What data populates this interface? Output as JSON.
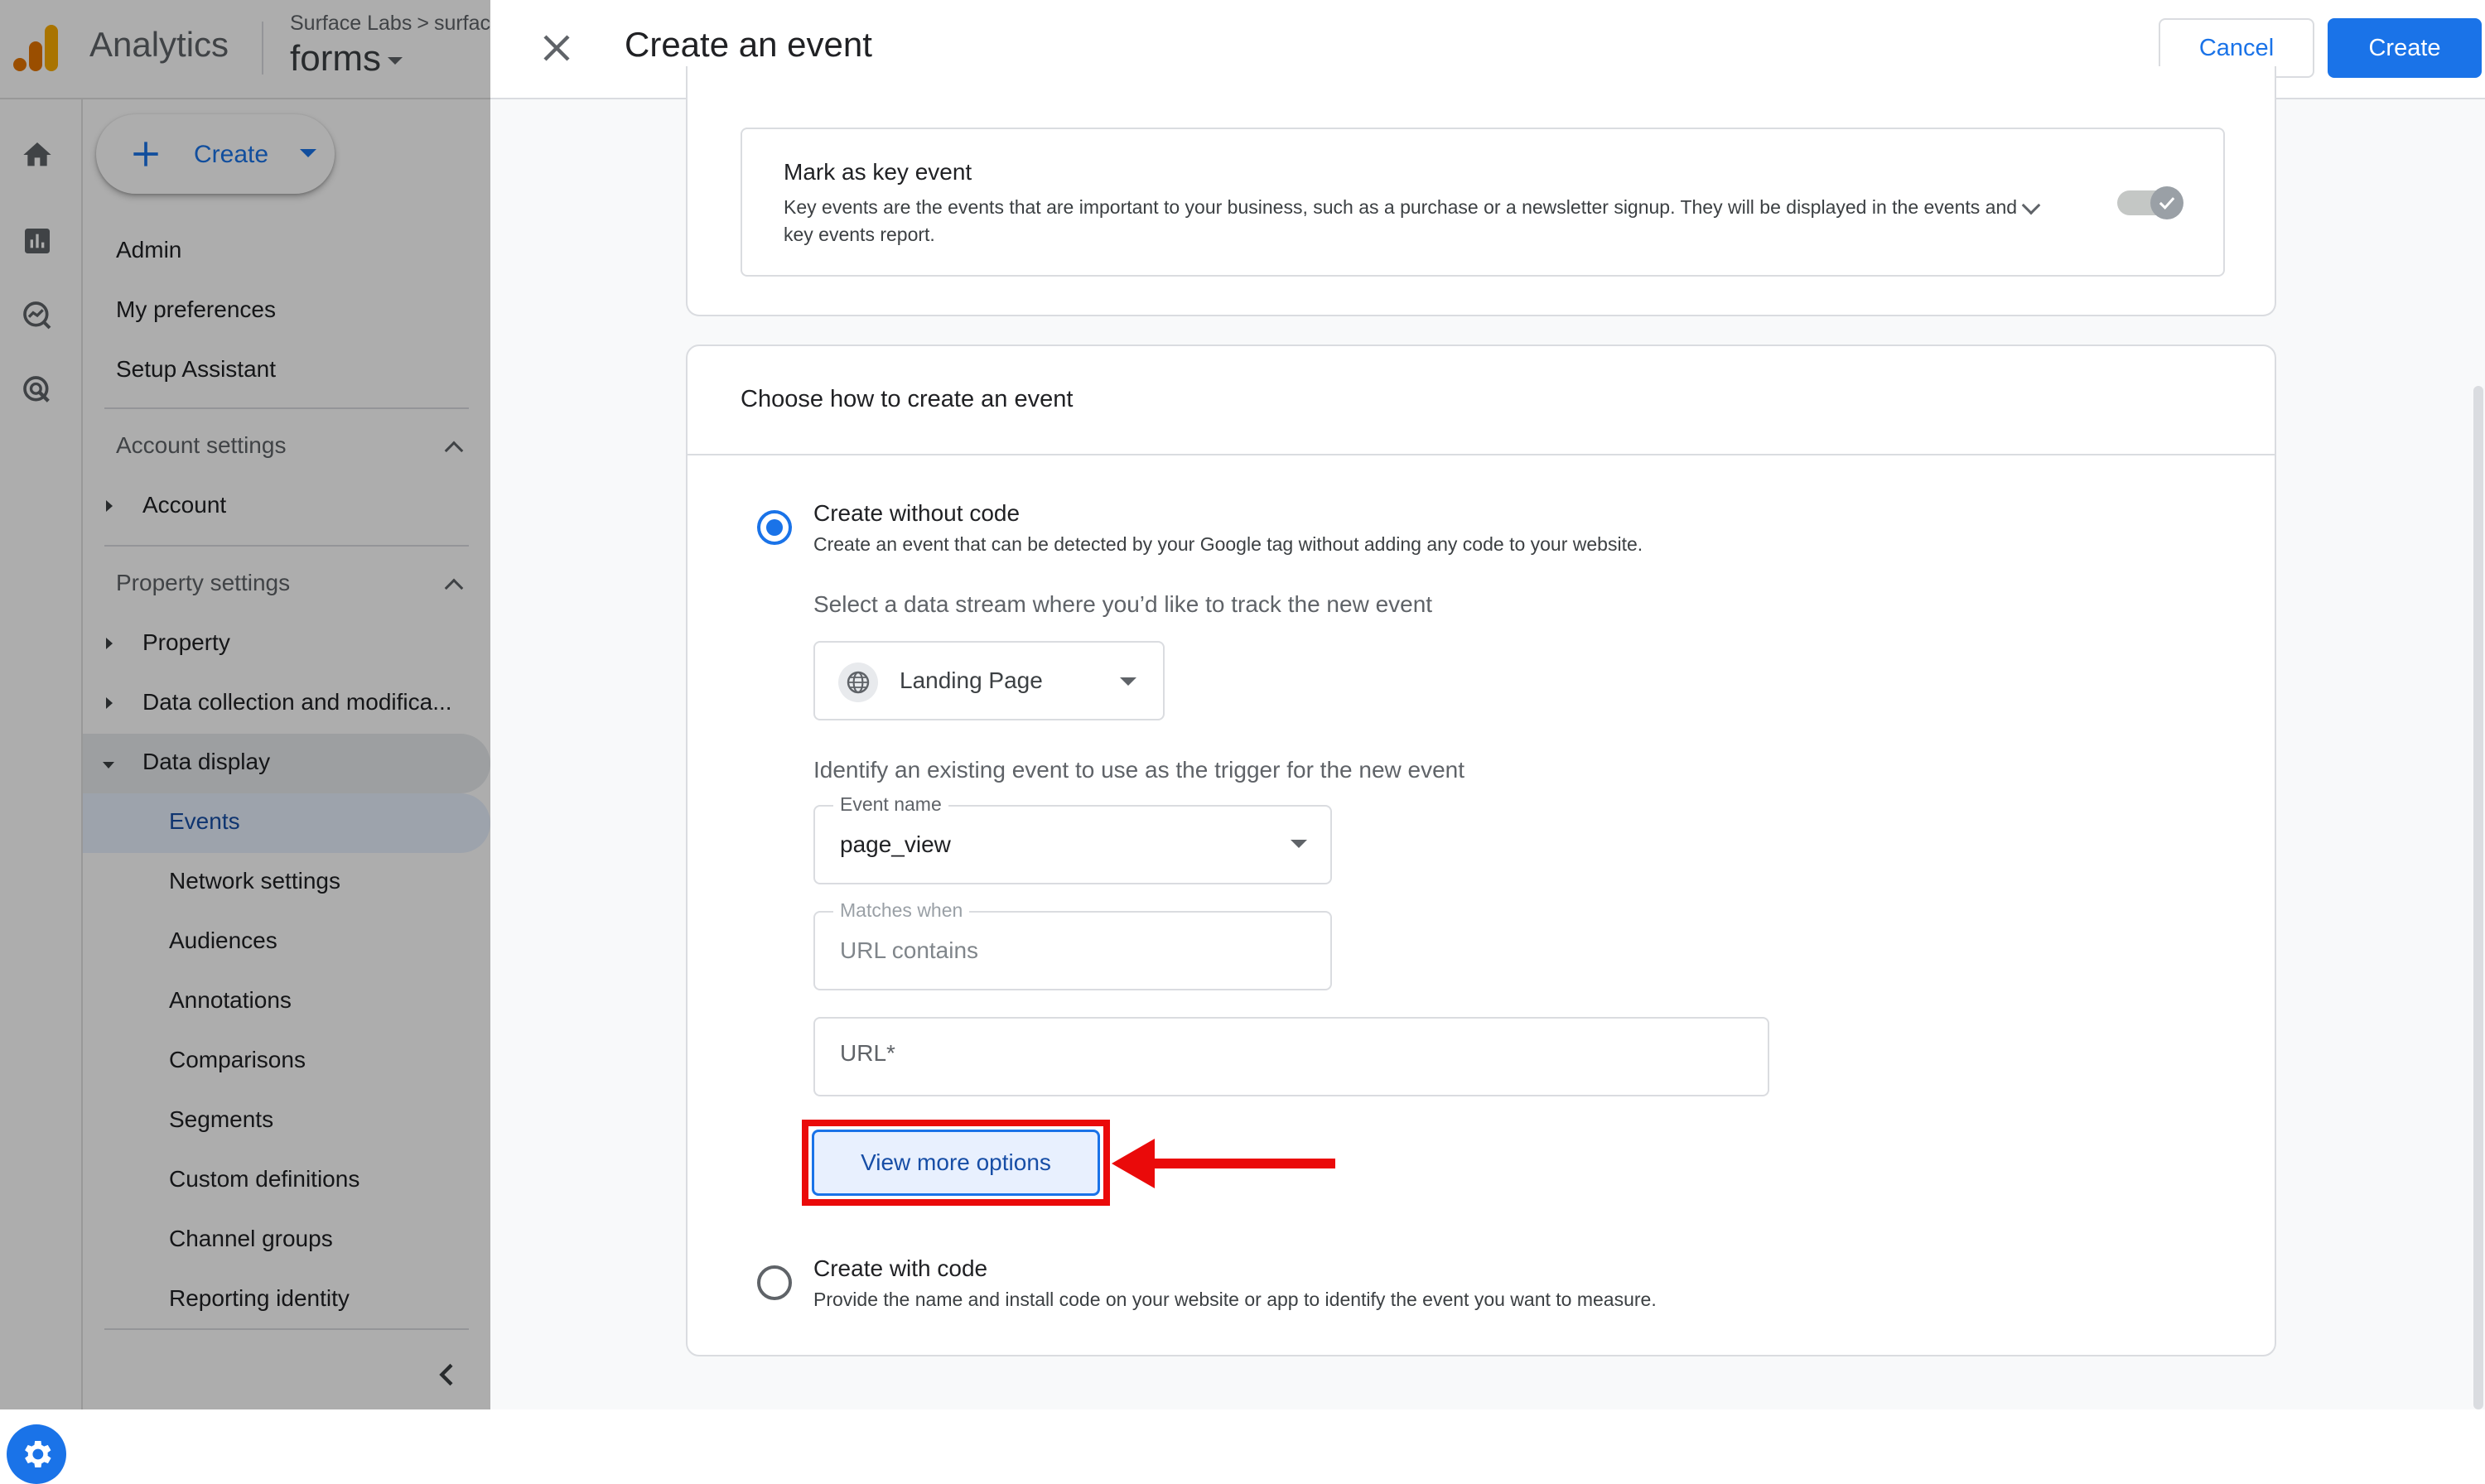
{
  "app": {
    "product_name": "Analytics",
    "breadcrumb_org": "Surface Labs",
    "breadcrumb_sep": ">",
    "breadcrumb_account": "surfac",
    "property_name": "forms"
  },
  "nav": {
    "create_label": "Create",
    "admin": "Admin",
    "my_preferences": "My preferences",
    "setup_assistant": "Setup Assistant",
    "account_settings": "Account settings",
    "account": "Account",
    "property_settings": "Property settings",
    "property": "Property",
    "data_collection": "Data collection and modifica...",
    "data_display": "Data display",
    "sub_items": [
      "Events",
      "Network settings",
      "Audiences",
      "Annotations",
      "Comparisons",
      "Segments",
      "Custom definitions",
      "Channel groups",
      "Reporting identity"
    ]
  },
  "panel": {
    "title": "Create an event",
    "cancel_label": "Cancel",
    "create_label": "Create"
  },
  "key_event": {
    "title": "Mark as key event",
    "description": "Key events are the events that are important to your business, such as a purchase or a newsletter signup. They will be displayed in the events and key events report.",
    "toggle_on": true
  },
  "create_section": {
    "title": "Choose how to create an event",
    "option_without_code": {
      "title": "Create without code",
      "description": "Create an event that can be detected by your Google tag without adding any code to your website.",
      "selected": true
    },
    "stream_hint": "Select a data stream where you’d like to track the new event",
    "stream_value": "Landing Page",
    "trigger_hint": "Identify an existing event to use as the trigger for the new event",
    "event_name_label": "Event name",
    "event_name_value": "page_view",
    "matches_when_label": "Matches when",
    "matches_when_value": "URL contains",
    "url_placeholder": "URL*",
    "view_more_label": "View more options",
    "option_with_code": {
      "title": "Create with code",
      "description": "Provide the name and install code on your website or app to identify the event you want to measure.",
      "selected": false
    }
  },
  "colors": {
    "accent": "#1a73e8",
    "annotation_red": "#ea0a0a",
    "logo_orange": "#f9ab00",
    "logo_dark": "#e37400"
  }
}
